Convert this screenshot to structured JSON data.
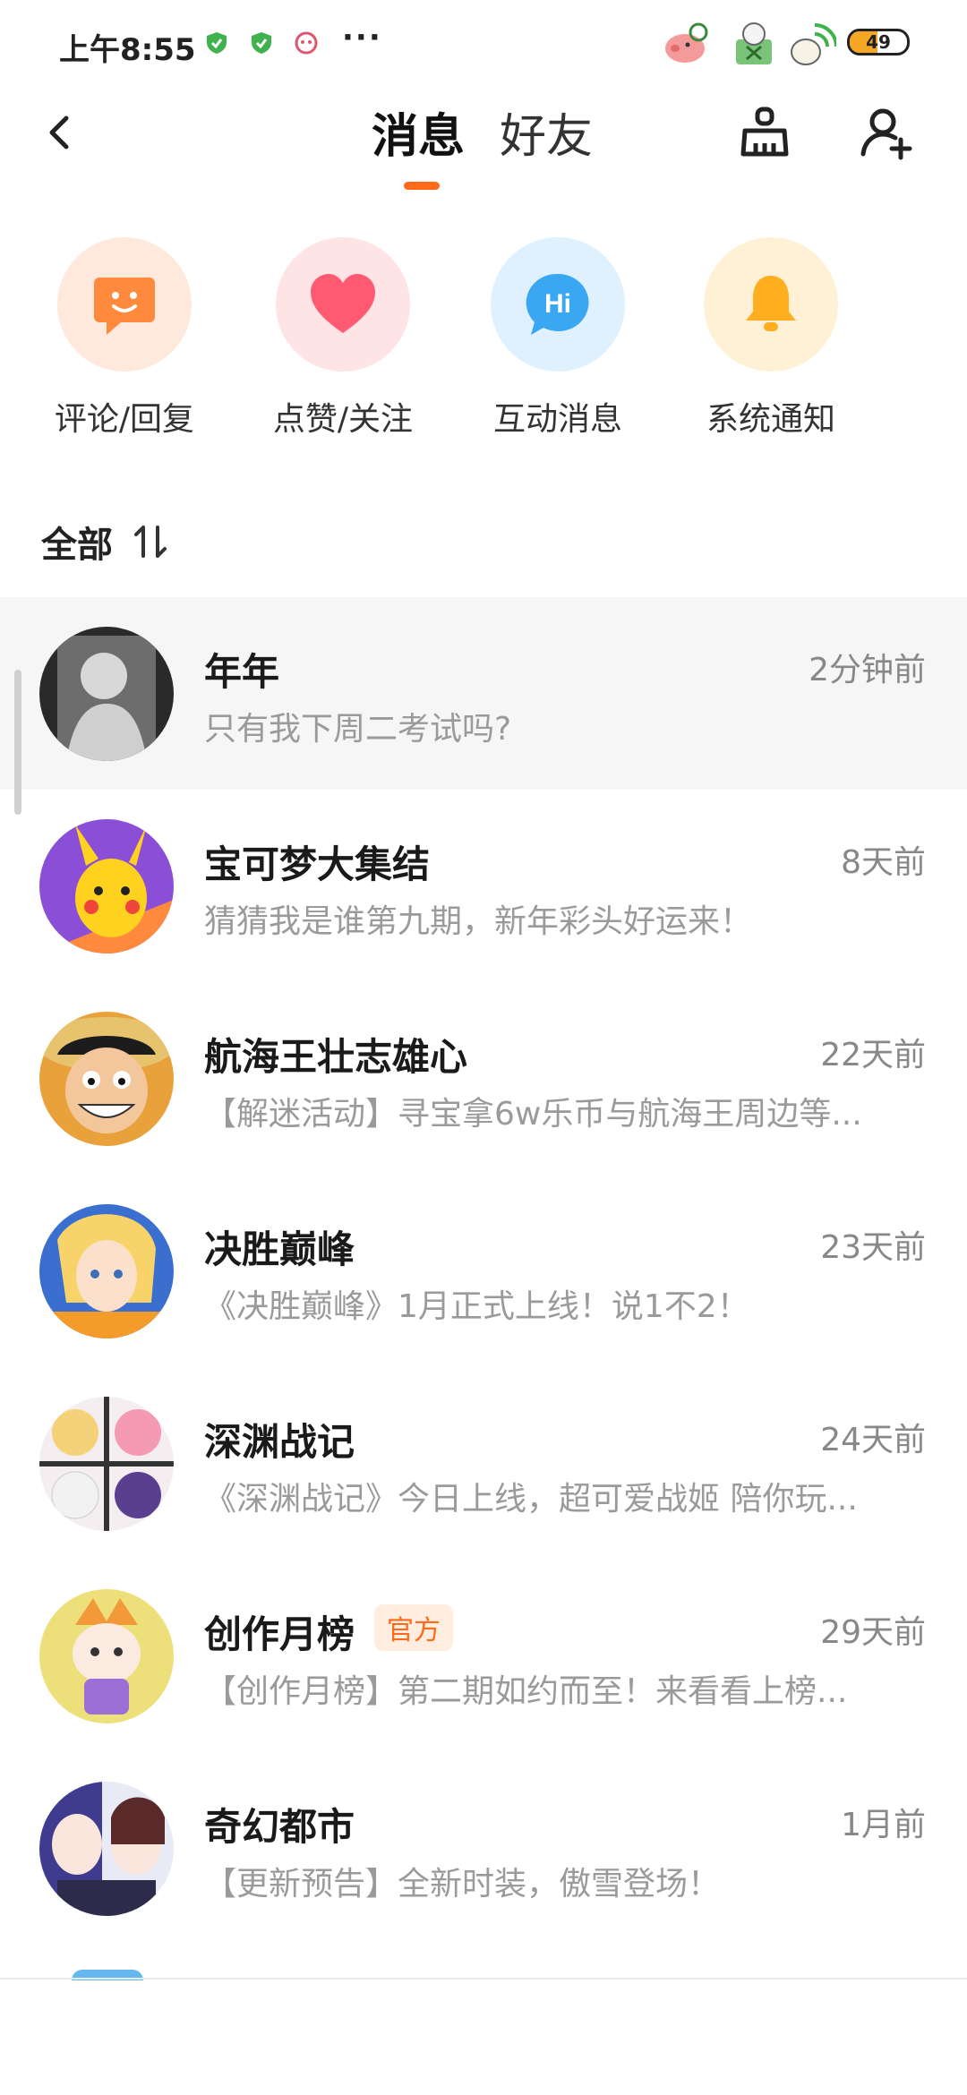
{
  "status_bar": {
    "time": "上午8:55",
    "battery": "49",
    "battery_level": 0.49,
    "battery_color": "#f5a623"
  },
  "nav": {
    "back_icon": "chevron-left-icon",
    "tabs": [
      {
        "label": "消息",
        "active": true
      },
      {
        "label": "好友",
        "active": false
      }
    ],
    "accent": "#ff6a1a",
    "right_icons": [
      "broom-clean-icon",
      "add-user-icon"
    ]
  },
  "categories": [
    {
      "label": "评论/回复",
      "icon": "comment-face-icon",
      "bg": "#ffe9dc",
      "fg": "#ff8a3d"
    },
    {
      "label": "点赞/关注",
      "icon": "heart-icon",
      "bg": "#ffe4e6",
      "fg": "#ff5a72"
    },
    {
      "label": "互动消息",
      "icon": "hi-bubble-icon",
      "bg": "#dff1ff",
      "fg": "#3aa7f2"
    },
    {
      "label": "系统通知",
      "icon": "bell-icon",
      "bg": "#fff1d6",
      "fg": "#ffae1f"
    }
  ],
  "filter": {
    "label": "全部",
    "icon": "sort-icon"
  },
  "messages": [
    {
      "name": "年年",
      "time": "2分钟前",
      "preview": "只有我下周二考试吗?",
      "highlight": true
    },
    {
      "name": "宝可梦大集结",
      "time": "8天前",
      "preview": "猜猜我是谁第九期，新年彩头好运来！"
    },
    {
      "name": "航海王壮志雄心",
      "time": "22天前",
      "preview": "【解迷活动】寻宝拿6w乐币与航海王周边等..."
    },
    {
      "name": "决胜巅峰",
      "time": "23天前",
      "preview": "《决胜巅峰》1月正式上线！说1不2！"
    },
    {
      "name": "深渊战记",
      "time": "24天前",
      "preview": "《深渊战记》今日上线，超可爱战姬 陪你玩..."
    },
    {
      "name": "创作月榜",
      "time": "29天前",
      "preview": "【创作月榜】第二期如约而至！来看看上榜...",
      "badge": "官方"
    },
    {
      "name": "奇幻都市",
      "time": "1月前",
      "preview": "【更新预告】全新时装，傲雪登场！"
    }
  ]
}
